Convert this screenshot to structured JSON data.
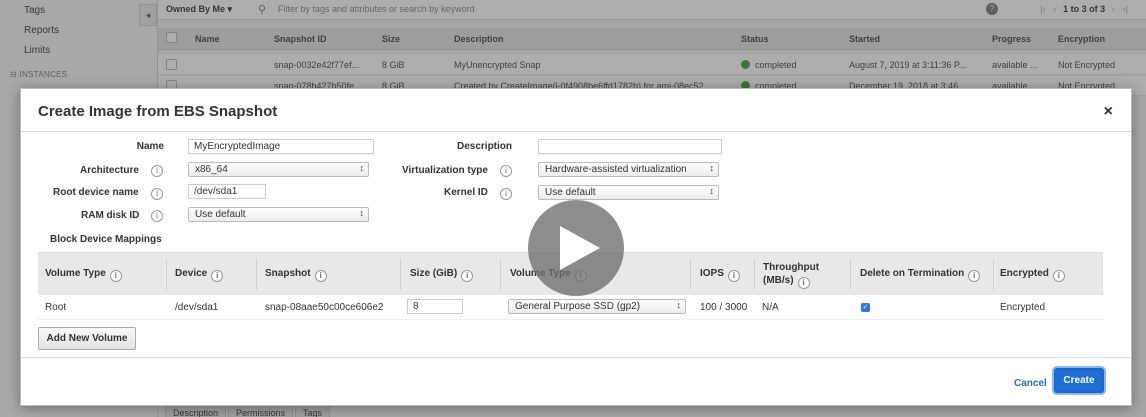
{
  "background": {
    "sidebar": {
      "items": [
        "Tags",
        "Reports",
        "Limits"
      ],
      "section": "INSTANCES",
      "collapse_icon": "◂"
    },
    "filter": {
      "owner": "Owned By Me",
      "search_placeholder": "Filter by tags and attributes or search by keyword",
      "pager": "1 to 3 of 3"
    },
    "table": {
      "columns": [
        "Name",
        "Snapshot ID",
        "Size",
        "Description",
        "Status",
        "Started",
        "Progress",
        "Encryption"
      ],
      "rows": [
        {
          "name": "",
          "snapshot_id": "snap-0032e42f77ef...",
          "size": "8 GiB",
          "description": "MyUnencrypted Snap",
          "status": "completed",
          "started": "August 7, 2019 at 3:11:36 P...",
          "progress": "available ...",
          "encryption": "Not Encrypted"
        },
        {
          "name": "",
          "snapshot_id": "snap-078b427b50fe...",
          "size": "8 GiB",
          "description": "Created by CreateImage(i-0f4908be6ffd1782b) for ami-08ec52...",
          "status": "completed",
          "started": "December 19, 2018 at 3:46...",
          "progress": "available ...",
          "encryption": "Not Encrypted"
        }
      ]
    },
    "bottom_tabs": [
      "Description",
      "Permissions",
      "Tags"
    ],
    "status_color": "#3ca13c"
  },
  "modal": {
    "title": "Create Image from EBS Snapshot",
    "close_icon": "×",
    "fields": {
      "name": {
        "label": "Name",
        "value": "MyEncryptedImage"
      },
      "description": {
        "label": "Description",
        "value": ""
      },
      "architecture": {
        "label": "Architecture",
        "value": "x86_64"
      },
      "virtualization": {
        "label": "Virtualization type",
        "value": "Hardware-assisted virtualization"
      },
      "root_device": {
        "label": "Root device name",
        "value": "/dev/sda1"
      },
      "kernel": {
        "label": "Kernel ID",
        "value": "Use default"
      },
      "ramdisk": {
        "label": "RAM disk ID",
        "value": "Use default"
      }
    },
    "block_device_title": "Block Device Mappings",
    "grid": {
      "headers": {
        "volume_type": "Volume Type",
        "device": "Device",
        "snapshot": "Snapshot",
        "size": "Size (GiB)",
        "volume_type2": "Volume Type",
        "iops": "IOPS",
        "throughput_1": "Throughput",
        "throughput_2": "(MB/s)",
        "delete_on_termination": "Delete on Termination",
        "encrypted": "Encrypted"
      },
      "row": {
        "volume_type": "Root",
        "device": "/dev/sda1",
        "snapshot": "snap-08aae50c00ce606e2",
        "size": "8",
        "volume_type_select": "General Purpose SSD (gp2)",
        "iops": "100 / 3000",
        "throughput": "N/A",
        "delete_on_termination": true,
        "encrypted": "Encrypted"
      }
    },
    "add_volume_button": "Add New Volume",
    "cancel_button": "Cancel",
    "create_button": "Create",
    "info_icon": "i",
    "caret_icon": "↕",
    "accent_color": "#1f6ed4"
  }
}
